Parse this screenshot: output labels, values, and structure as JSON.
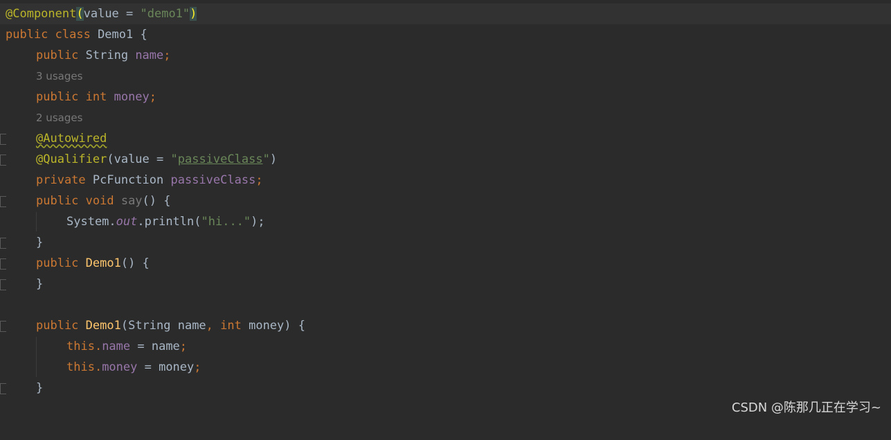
{
  "editor": {
    "lines": {
      "l1": {
        "t1": "@Component",
        "t2": "(",
        "t3": "value = ",
        "t4": "\"demo1\"",
        "t5": ")"
      },
      "l2": {
        "t1": "public class ",
        "t2": "Demo1 {"
      },
      "l3": {
        "t1": "public ",
        "t2": "String ",
        "t3": "name",
        "t4": ";"
      },
      "l4": {
        "hint": "3 usages"
      },
      "l5": {
        "t1": "public int ",
        "t2": "money",
        "t3": ";"
      },
      "l6": {
        "hint": "2 usages"
      },
      "l7": {
        "t1": "@Autowired"
      },
      "l8": {
        "t1": "@Qualifier",
        "t2": "(value = ",
        "t3": "\"",
        "t4": "passiveClass",
        "t5": "\"",
        "t6": ")"
      },
      "l9": {
        "t1": "private ",
        "t2": "PcFunction ",
        "t3": "passiveClass",
        "t4": ";"
      },
      "l10": {
        "t1": "public void ",
        "t2": "say",
        "t3": "() {"
      },
      "l11": {
        "t1": "System.",
        "t2": "out",
        "t3": ".println(",
        "t4": "\"hi...\"",
        "t5": ");"
      },
      "l12": {
        "t1": "}"
      },
      "l13": {
        "t1": "public ",
        "t2": "Demo1",
        "t3": "() {"
      },
      "l14": {
        "t1": "}"
      },
      "l15": {
        "t1": "public ",
        "t2": "Demo1",
        "t3": "(String name",
        "t4": ", int ",
        "t5": "money) {"
      },
      "l16": {
        "t1": "this.",
        "t2": "name",
        "t3": " = name",
        "t4": ";"
      },
      "l17": {
        "t1": "this.",
        "t2": "money",
        "t3": " = money",
        "t4": ";"
      },
      "l18": {
        "t1": "}"
      }
    }
  },
  "watermark": {
    "text": "CSDN @陈那几正在学习~"
  },
  "colors": {
    "background": "#2b2b2b",
    "keyword": "#cc7832",
    "annotation": "#bbb529",
    "string": "#6a8759",
    "field": "#9876aa",
    "method": "#ffc66d",
    "text": "#a9b7c6",
    "hint": "#787878"
  }
}
